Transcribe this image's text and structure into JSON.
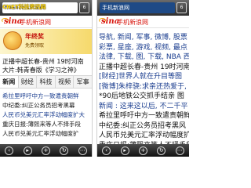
{
  "left": {
    "url": "finance.sina.cn",
    "tab_count": "6",
    "watermark": "CNET科技资讯网",
    "logo_mark": "sina",
    "logo_text": "手机新浪网",
    "ad": {
      "title": "年终奖",
      "subtitle": "免费领取"
    },
    "headlines": [
      "正播中超长春-贵州 19时河南",
      "大片:韩青春版《学习之神》"
    ],
    "nav": [
      "新闻",
      "财经",
      "科技",
      "视频",
      "军事"
    ],
    "news": [
      "希拉里呼吁中方一致遣责朝鲜",
      "中纪委:纠正公务员招考黑幕",
      "人民币兑美元汇率浮动幅度扩大",
      "重庆日报:薄熙来等人不择手段",
      "人民币兑美元汇率浮动幅度扩"
    ]
  },
  "right": {
    "url": "手机新浪网",
    "tab_count": "6",
    "logo_mark": "sina",
    "logo_text": "手机新浪网",
    "lines": [
      {
        "text": "导航, 新闻, 军事, 微博, 股票",
        "style": "link"
      },
      {
        "text": "彩票, 星座, 游戏, 视频, 最点",
        "style": "link"
      },
      {
        "text": "法律, 下载, 图, 下载, NBA 西,谭",
        "style": "link"
      },
      {
        "text": "正播中超长春-贵州 19时河南",
        "style": "black"
      },
      {
        "text": "[财经]世界人就在升目等图",
        "style": "link"
      },
      {
        "text": "[微博]朱梓骁:求亲还热爱于, 图",
        "style": "link"
      },
      {
        "text": "*90后地铁公交抓手结亲 图",
        "style": "black"
      },
      {
        "text": "新闻 : 这来这以后, 不二千平",
        "style": "link"
      },
      {
        "text": "希拉里呼吁中方一致遣责朝鲜",
        "style": "black"
      },
      {
        "text": "中纪委:纠正公务员招考黑风",
        "style": "black"
      },
      {
        "text": "人民币兑美元汇率浮动幅度扩大",
        "style": "black"
      },
      {
        "text": "重庆日报:薄熙来等人不择手段",
        "style": "black"
      }
    ]
  }
}
